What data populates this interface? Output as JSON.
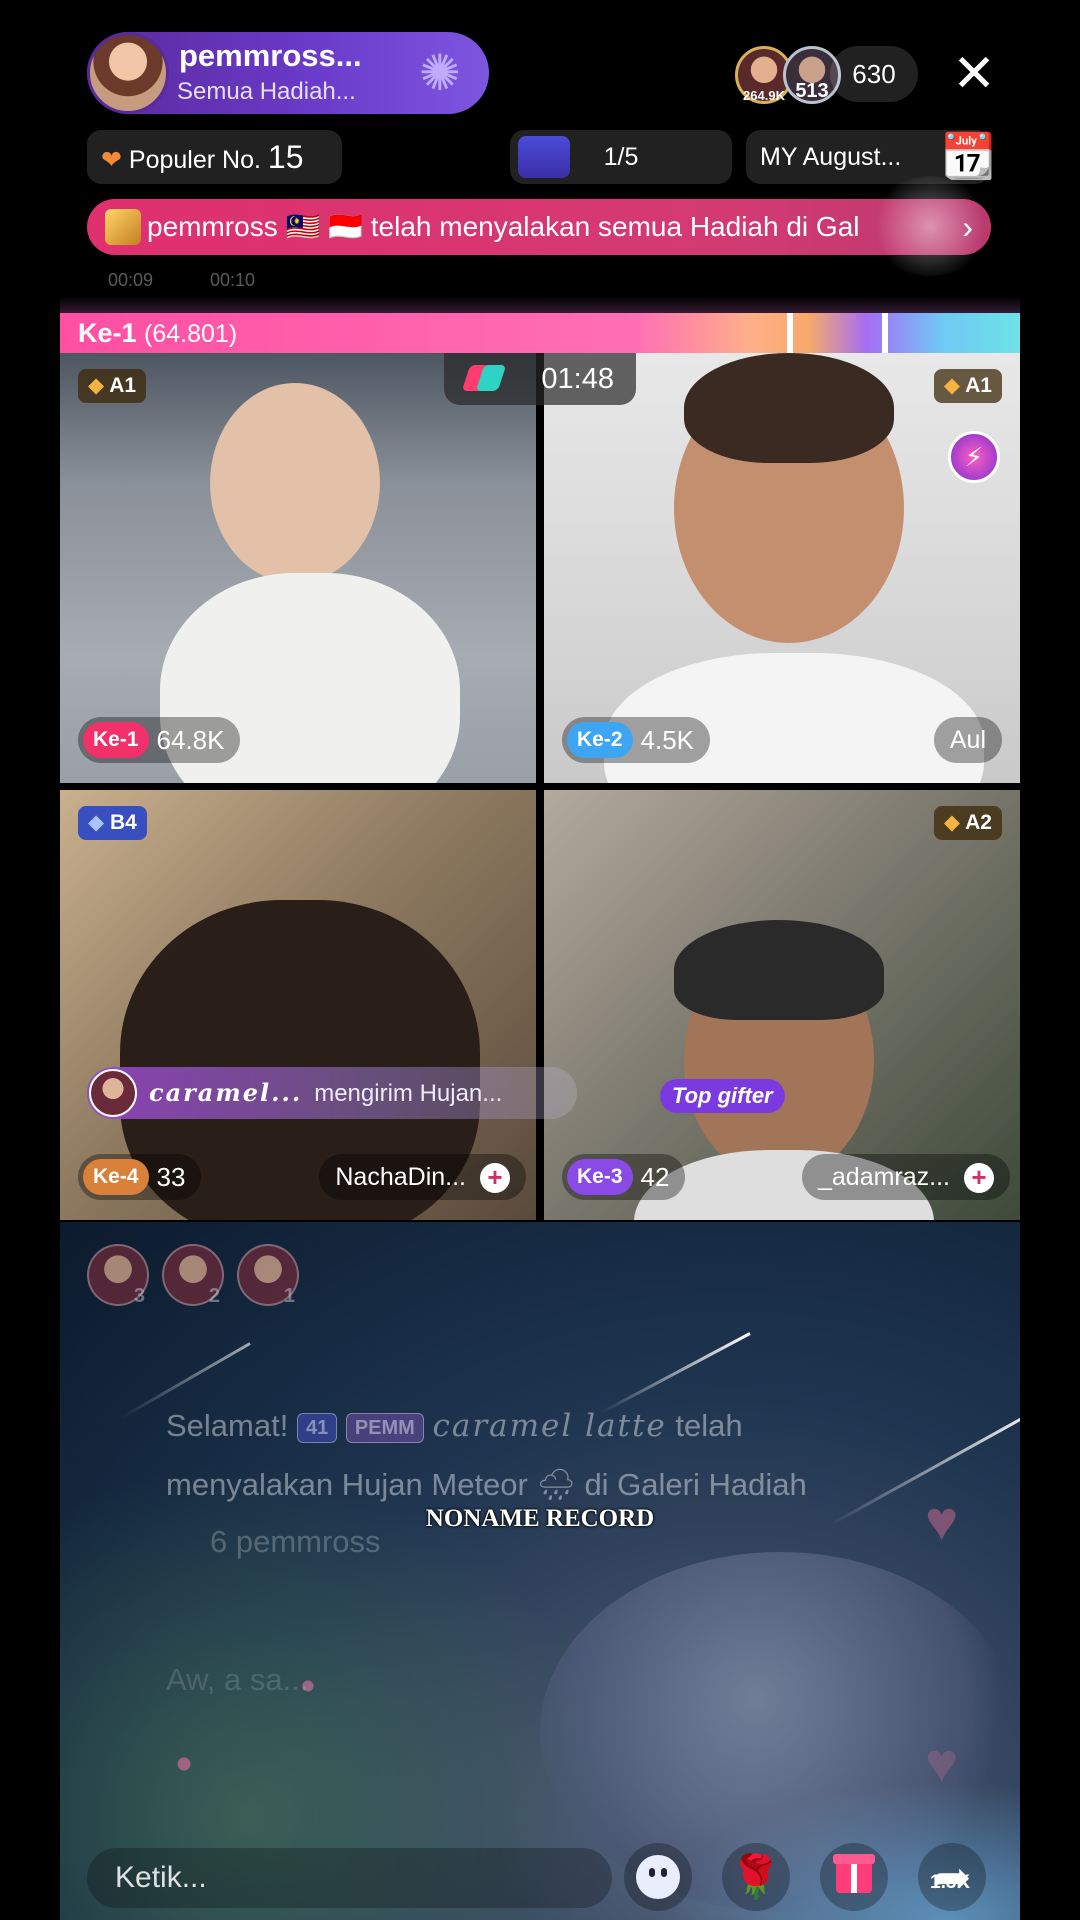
{
  "host": {
    "name": "pemmross...",
    "subtitle": "Semua Hadiah..."
  },
  "viewers": {
    "avatar1_count": "264.9K",
    "avatar2_count": "513",
    "total": "630"
  },
  "chips": {
    "popular_label": "Populer No.",
    "popular_rank": "15",
    "page": "1/5",
    "event": "MY August..."
  },
  "banner": {
    "text": "pemmross 🇲🇾 🇮🇩 telah menyalakan semua Hadiah di Gal",
    "chevron": "›"
  },
  "faint_times": [
    "00:09",
    "00:10"
  ],
  "battle": {
    "leader": "Ke-1",
    "leader_score": "(64.801)",
    "timer": "01:48"
  },
  "tiles": [
    {
      "badge": "A1",
      "rank": "Ke-1",
      "score": "64.8K",
      "name": ""
    },
    {
      "badge": "A1",
      "rank": "Ke-2",
      "score": "4.5K",
      "name": "Aul"
    },
    {
      "badge": "B4",
      "rank": "Ke-4",
      "score": "33",
      "name": "NachaDin..."
    },
    {
      "badge": "A2",
      "rank": "Ke-3",
      "score": "42",
      "name": "_adamraz..."
    }
  ],
  "gift_toast": {
    "name": "caramel...",
    "message": "mengirim Hujan..."
  },
  "top_gifter_label": "Top gifter",
  "top_avatars": [
    "3",
    "2",
    "1"
  ],
  "chat": {
    "line1_prefix": "Selamat!",
    "line1_badge1": "41",
    "line1_badge2": "PEMM",
    "line1_name": "caramel latte",
    "line1_suffix": "telah",
    "line2": "menyalakan Hujan Meteor 🌧 di Galeri Hadiah",
    "line3": "6 pemmross",
    "line4": "Aw, a sa..."
  },
  "watermark": "NONAME RECORD",
  "comment_placeholder": "Ketik...",
  "share_count": "1.3K",
  "colors": {
    "rank1": "#f2306a",
    "rank2": "#3da5f2",
    "rank3": "#8a4ae6",
    "rank4": "#d9813a",
    "banner": "#e0306f"
  }
}
